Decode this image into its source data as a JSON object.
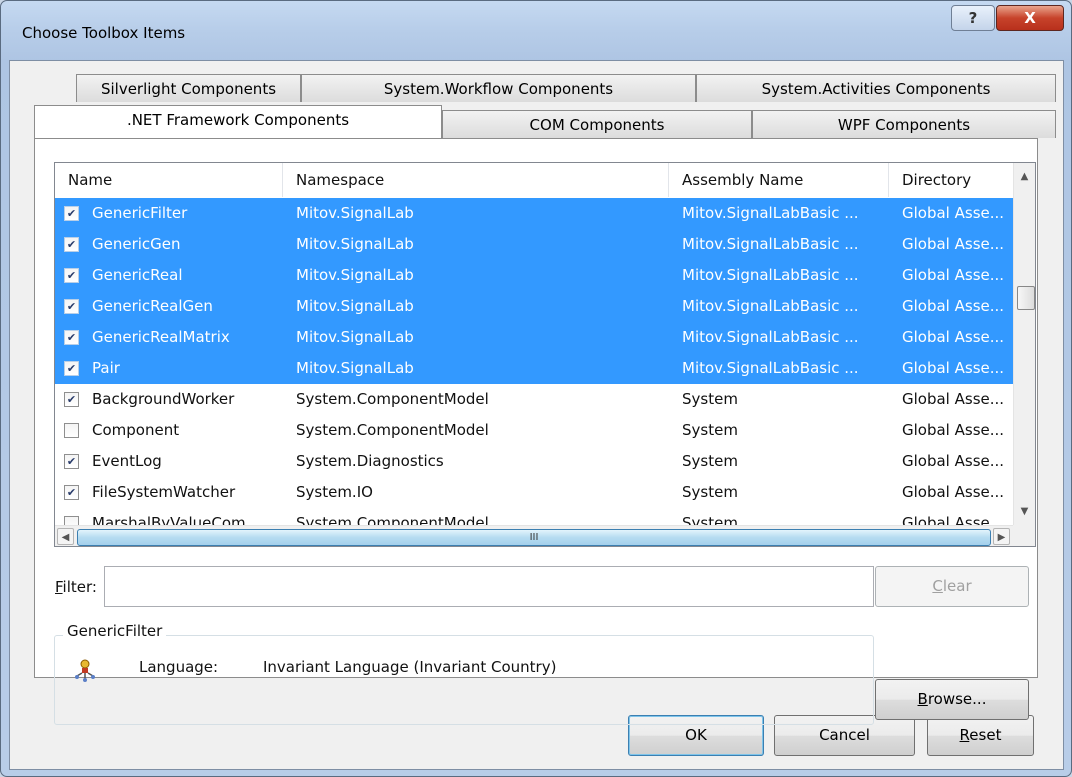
{
  "window": {
    "title": "Choose Toolbox Items",
    "help_glyph": "?",
    "close_glyph": "X"
  },
  "tabs": {
    "back_row": [
      "Silverlight Components",
      "System.Workflow Components",
      "System.Activities Components"
    ],
    "front_row": [
      ".NET Framework Components",
      "COM Components",
      "WPF Components"
    ],
    "active": ".NET Framework Components"
  },
  "grid": {
    "columns": [
      "Name",
      "Namespace",
      "Assembly Name",
      "Directory"
    ],
    "rows": [
      {
        "checked": true,
        "selected": true,
        "name": "GenericFilter",
        "namespace": "Mitov.SignalLab",
        "assembly": "Mitov.SignalLabBasic ...",
        "directory": "Global Asse..."
      },
      {
        "checked": true,
        "selected": true,
        "name": "GenericGen",
        "namespace": "Mitov.SignalLab",
        "assembly": "Mitov.SignalLabBasic ...",
        "directory": "Global Asse..."
      },
      {
        "checked": true,
        "selected": true,
        "name": "GenericReal",
        "namespace": "Mitov.SignalLab",
        "assembly": "Mitov.SignalLabBasic ...",
        "directory": "Global Asse..."
      },
      {
        "checked": true,
        "selected": true,
        "name": "GenericRealGen",
        "namespace": "Mitov.SignalLab",
        "assembly": "Mitov.SignalLabBasic ...",
        "directory": "Global Asse..."
      },
      {
        "checked": true,
        "selected": true,
        "name": "GenericRealMatrix",
        "namespace": "Mitov.SignalLab",
        "assembly": "Mitov.SignalLabBasic ...",
        "directory": "Global Asse..."
      },
      {
        "checked": true,
        "selected": true,
        "name": "Pair",
        "namespace": "Mitov.SignalLab",
        "assembly": "Mitov.SignalLabBasic ...",
        "directory": "Global Asse..."
      },
      {
        "checked": true,
        "selected": false,
        "name": "BackgroundWorker",
        "namespace": "System.ComponentModel",
        "assembly": "System",
        "directory": "Global Asse..."
      },
      {
        "checked": false,
        "selected": false,
        "name": "Component",
        "namespace": "System.ComponentModel",
        "assembly": "System",
        "directory": "Global Asse..."
      },
      {
        "checked": true,
        "selected": false,
        "name": "EventLog",
        "namespace": "System.Diagnostics",
        "assembly": "System",
        "directory": "Global Asse..."
      },
      {
        "checked": true,
        "selected": false,
        "name": "FileSystemWatcher",
        "namespace": "System.IO",
        "assembly": "System",
        "directory": "Global Asse..."
      },
      {
        "checked": false,
        "selected": false,
        "name": "MarshalByValueCom...",
        "namespace": "System.ComponentModel",
        "assembly": "System",
        "directory": "Global Asse..."
      }
    ],
    "hscroll_grip": "III"
  },
  "filter": {
    "label_mnemonic": "F",
    "label_rest": "ilter:",
    "value": ""
  },
  "clear_button": {
    "mnemonic": "C",
    "rest": "lear"
  },
  "info": {
    "title": "GenericFilter",
    "language_label": "Language:",
    "language_value": "Invariant Language (Invariant Country)"
  },
  "browse_button": {
    "mnemonic": "B",
    "rest": "rowse..."
  },
  "ok_button": "OK",
  "cancel_button": "Cancel",
  "reset_button": {
    "mnemonic": "R",
    "rest": "eset"
  },
  "colors": {
    "selection": "#3399ff",
    "window_frame": "#b7cde9",
    "close_red": "#c7432b"
  }
}
